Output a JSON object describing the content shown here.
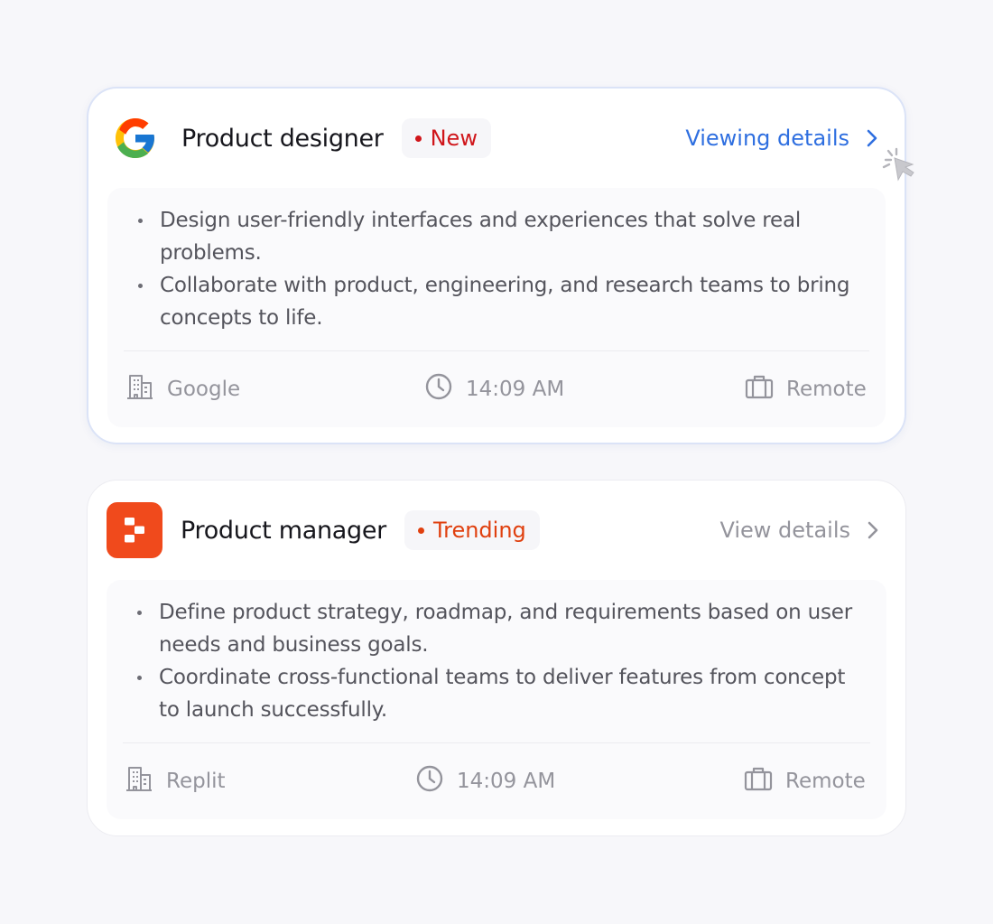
{
  "jobs": [
    {
      "logo": "google-logo",
      "title": "Product designer",
      "badge": "New",
      "badge_color": "#d0161b",
      "details_label": "Viewing details",
      "details_color": "#2f6fe0",
      "bullets": [
        "Design user-friendly interfaces and experiences that solve real problems.",
        "Collaborate with product, engineering, and research teams to bring concepts to life."
      ],
      "company": "Google",
      "time": "14:09 AM",
      "location": "Remote"
    },
    {
      "logo": "replit-logo",
      "title": "Product manager",
      "badge": "Trending",
      "badge_color": "#e0400f",
      "details_label": "View details",
      "details_color": "#94949c",
      "bullets": [
        "Define product strategy, roadmap, and requirements based on user needs and business goals.",
        "Coordinate cross-functional teams to deliver features from concept to launch successfully."
      ],
      "company": "Replit",
      "time": "14:09 AM",
      "location": "Remote"
    }
  ],
  "icons": {
    "company": "building-icon",
    "time": "clock-icon",
    "location": "briefcase-icon",
    "details": "chevron-right-icon",
    "pointer": "cursor-click-icon"
  },
  "colors": {
    "accent_blue": "#2f6fe0",
    "replit_orange": "#f04a1c",
    "text_primary": "#16161c",
    "text_muted": "#94949c"
  }
}
